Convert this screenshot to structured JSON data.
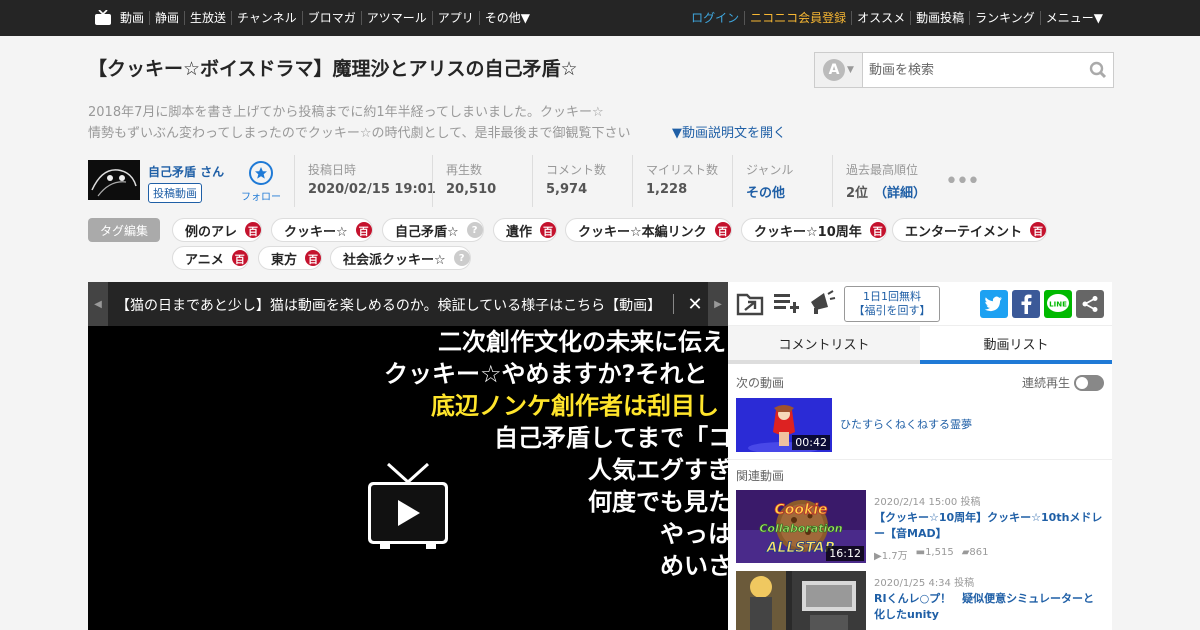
{
  "nav": {
    "left": [
      "動画",
      "静画",
      "生放送",
      "チャンネル",
      "ブロマガ",
      "アツマール",
      "アプリ",
      "その他▼"
    ],
    "login": "ログイン",
    "register": "ニコニコ会員登録",
    "right": [
      "オススメ",
      "動画投稿",
      "ランキング",
      "メニュー▼"
    ]
  },
  "video": {
    "title": "【クッキー☆ボイスドラマ】魔理沙とアリスの自己矛盾☆",
    "description_line1": "2018年7月に脚本を書き上げてから投稿までに約1年半経ってしまいました。クッキー☆",
    "description_line2": "情勢もずいぶん変わってしまったのでクッキー☆の時代劇として、是非最後まで御観覧下さい",
    "open_description": "▼動画説明文を開く"
  },
  "search": {
    "type_letter": "A",
    "placeholder": "動画を検索"
  },
  "owner": {
    "name": "自己矛盾 さん",
    "videos_label": "投稿動画",
    "follow_label": "フォロー"
  },
  "stats": [
    {
      "label": "投稿日時",
      "value": "2020/02/15 19:01"
    },
    {
      "label": "再生数",
      "value": "20,510"
    },
    {
      "label": "コメント数",
      "value": "5,974"
    },
    {
      "label": "マイリスト数",
      "value": "1,228"
    },
    {
      "label": "ジャンル",
      "value": "その他"
    },
    {
      "label": "過去最高順位",
      "value": "2位",
      "detail": "（詳細）"
    }
  ],
  "more": "•••",
  "tag_edit": "タグ編集",
  "tags": [
    {
      "label": "例のアレ",
      "dic": "百",
      "type": "red"
    },
    {
      "label": "クッキー☆",
      "dic": "百",
      "type": "red"
    },
    {
      "label": "自己矛盾☆",
      "dic": "?",
      "type": "gray"
    },
    {
      "label": "遺作",
      "dic": "百",
      "type": "red"
    },
    {
      "label": "クッキー☆本編リンク",
      "dic": "百",
      "type": "red"
    },
    {
      "label": "クッキー☆10周年",
      "dic": "百",
      "type": "red"
    },
    {
      "label": "エンターテイメント",
      "dic": "百",
      "type": "red"
    },
    {
      "label": "アニメ",
      "dic": "百",
      "type": "red"
    },
    {
      "label": "東方",
      "dic": "百",
      "type": "red"
    },
    {
      "label": "社会派クッキー☆",
      "dic": "?",
      "type": "gray"
    }
  ],
  "player": {
    "ticker": "【猫の日まであと少し】猫は動画を楽しめるのか。検証している様子はこちら【動画】",
    "close": "✕",
    "comments": [
      {
        "text": "二次創作文化の未来に伝え",
        "color": "white"
      },
      {
        "text": "クッキー☆やめますか?それと",
        "color": "white"
      },
      {
        "text": "底辺ノンケ創作者は刮目し",
        "color": "yellow"
      },
      {
        "text": "自己矛盾してまで「コ",
        "color": "white"
      },
      {
        "text": "人気エグすぎ",
        "color": "white"
      },
      {
        "text": "何度でも見た",
        "color": "white"
      },
      {
        "text": "やっは",
        "color": "white"
      },
      {
        "text": "めいさ",
        "color": "white"
      }
    ]
  },
  "side": {
    "boost_line1": "1日1回無料",
    "boost_line2": "【福引を回す】",
    "sns": {
      "line": "LINE"
    },
    "tabs": [
      "コメントリスト",
      "動画リスト"
    ],
    "next_label": "次の動画",
    "continuous": "連続再生",
    "next_video": {
      "title": "ひたすらくねくねする霊夢",
      "duration": "00:42"
    },
    "related_label": "関連動画",
    "related": [
      {
        "date": "2020/2/14 15:00 投稿",
        "title": "【クッキー☆10周年】クッキー☆10thメドレー【音MAD】",
        "duration": "16:12",
        "views": "1.7万",
        "comments": "1,515",
        "mylists": "861",
        "thumb_text": "Cookie Collaboration ALLSTAR"
      },
      {
        "date": "2020/1/25 4:34 投稿",
        "title": "RIくんレ○プ！　疑似便意シミュレーターと化したunity"
      }
    ]
  },
  "colors": {
    "accent": "#1f7ad6",
    "link": "#1f5fa6",
    "nav_bg": "#252525",
    "dic_red": "#c4122d",
    "comment_yellow": "#ffe52b",
    "twitter": "#1da1f2",
    "facebook": "#3b5998",
    "line": "#00b900"
  }
}
